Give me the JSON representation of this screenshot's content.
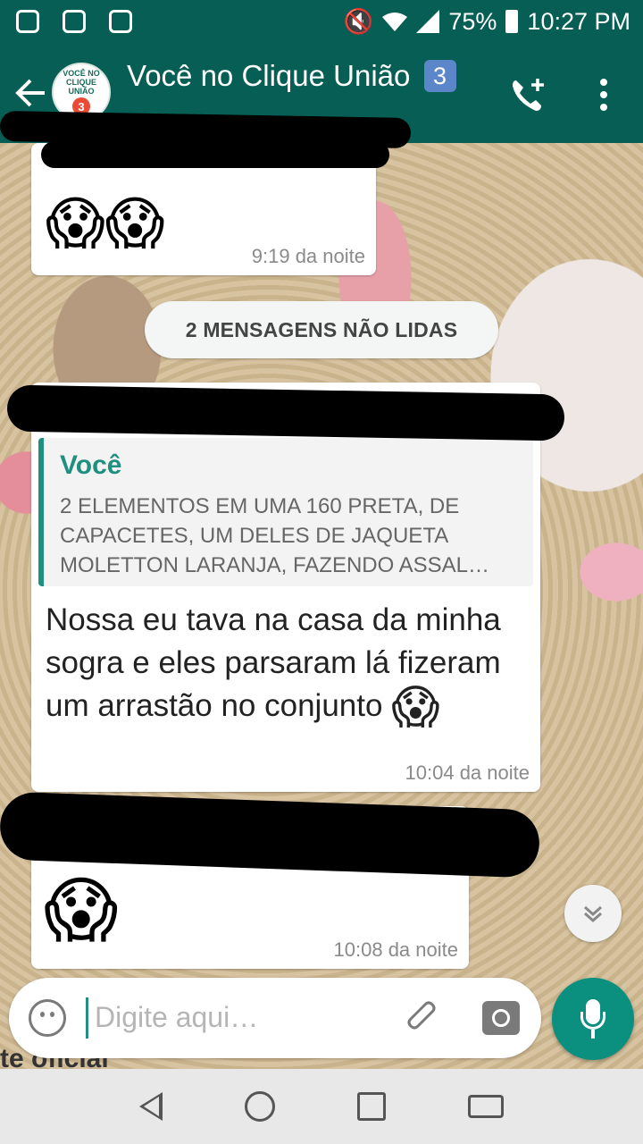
{
  "status_bar": {
    "battery": "75%",
    "time": "10:27 PM",
    "icons": [
      "instagram-icon",
      "vpn-icon",
      "news-icon",
      "mute-icon",
      "wifi-icon",
      "signal-icon",
      "battery-icon"
    ]
  },
  "header": {
    "title": "Você no Clique União",
    "badge": "3️⃣",
    "avatar_text": "VOCÊ NO CLIQUE UNIÃO",
    "avatar_number": "3"
  },
  "messages": [
    {
      "emoji": "😱😱",
      "time": "9:19 da noite"
    },
    {
      "quote_author": "Você",
      "quote_text": "2 ELEMENTOS EM UMA  160 PRETA, DE CAPACETES, UM DELES DE JAQUETA MOLETTON LARANJA, FAZENDO ASSAL…",
      "text": "Nossa eu tava na casa da minha sogra e eles parsaram lá fizeram um arrastão no conjunto",
      "emoji": "😱",
      "time": "10:04 da noite"
    },
    {
      "emoji": "😱",
      "time": "10:08 da noite"
    }
  ],
  "unread_divider": "2 MENSAGENS NÃO LIDAS",
  "input": {
    "placeholder": "Digite aqui…"
  },
  "behind_text": "te oficial",
  "colors": {
    "primary": "#075e54",
    "accent": "#1f8f7f",
    "mic": "#0b8f7e"
  }
}
